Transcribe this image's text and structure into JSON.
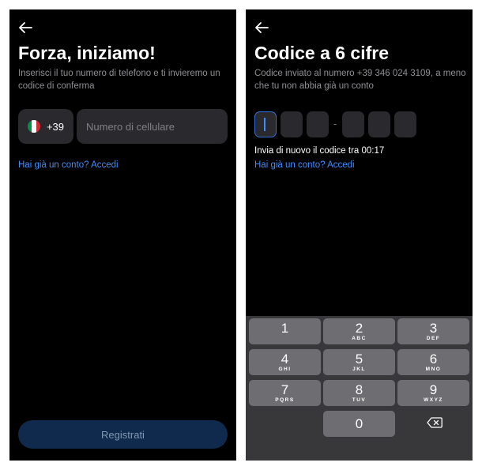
{
  "left": {
    "title": "Forza, iniziamo!",
    "subtitle": "Inserisci il tuo numero di telefono e ti invieremo un codice di conferma",
    "country_code": "+39",
    "flag": "italy-flag",
    "phone_placeholder": "Numero di cellulare",
    "login_link": "Hai già un conto? Accedi",
    "register_label": "Registrati"
  },
  "right": {
    "title": "Codice a 6 cifre",
    "subtitle": "Codice inviato al numero +39 346 024 3109, a meno che tu non abbia già un conto",
    "resend_text": "Invia di nuovo il codice tra 00:17",
    "login_link": "Hai già un conto? Accedi",
    "separator": "-",
    "keys": [
      {
        "num": "1",
        "letters": ""
      },
      {
        "num": "2",
        "letters": "ABC"
      },
      {
        "num": "3",
        "letters": "DEF"
      },
      {
        "num": "4",
        "letters": "GHI"
      },
      {
        "num": "5",
        "letters": "JKL"
      },
      {
        "num": "6",
        "letters": "MNO"
      },
      {
        "num": "7",
        "letters": "PQRS"
      },
      {
        "num": "8",
        "letters": "TUV"
      },
      {
        "num": "9",
        "letters": "WXYZ"
      },
      {
        "num": "0",
        "letters": ""
      }
    ]
  },
  "colors": {
    "background": "#000000",
    "field": "#2a2a2e",
    "link": "#3f8cff",
    "button": "#0f2a4d",
    "keypad": "#38383b",
    "key": "#6e6e72",
    "flag_green": "#009246",
    "flag_white": "#ffffff",
    "flag_red": "#ce2b37"
  }
}
